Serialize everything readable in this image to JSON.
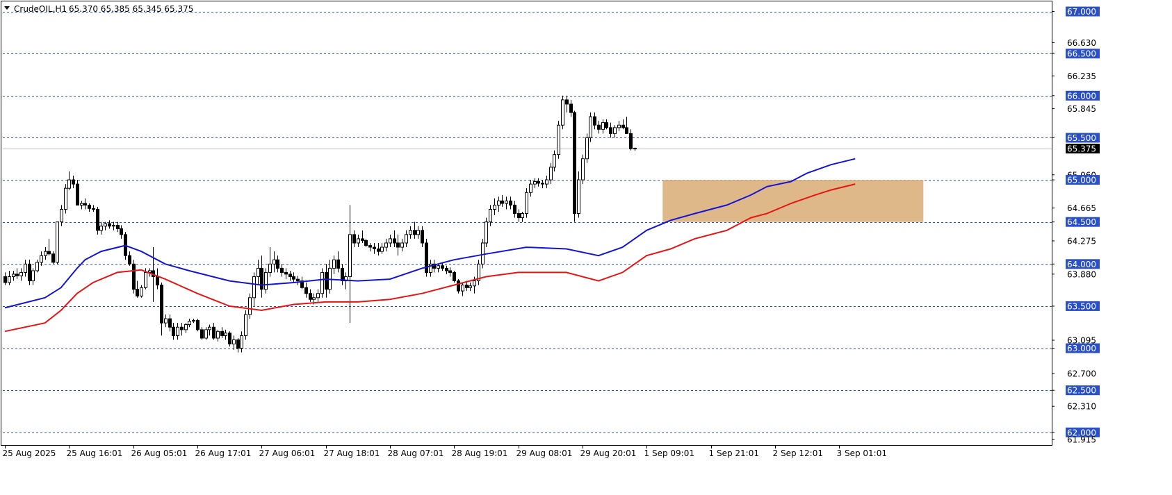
{
  "header": {
    "symbol_line": "CrudeOIL,H1",
    "ohlc": "65.370 65.385 65.345 65.375"
  },
  "colors": {
    "bull": "#ffffff",
    "bear": "#000000",
    "ma_fast": "#1414d6",
    "ma_slow": "#e81414",
    "level": "#2a50c8",
    "zone": "#d9ae78",
    "current": "#000000"
  },
  "chart_data": {
    "type": "candlestick",
    "ylim": [
      61.85,
      67.12
    ],
    "y_ticks": [
      "67.000",
      "66.630",
      "66.500",
      "66.235",
      "66.000",
      "65.845",
      "65.500",
      "65.060",
      "65.000",
      "64.665",
      "64.500",
      "64.275",
      "64.000",
      "63.880",
      "63.500",
      "63.095",
      "63.000",
      "62.700",
      "62.500",
      "62.310",
      "62.000",
      "61.915"
    ],
    "highlighted_levels": [
      "67.000",
      "66.500",
      "66.000",
      "65.500",
      "65.000",
      "64.500",
      "64.000",
      "63.500",
      "63.000",
      "62.500",
      "62.000"
    ],
    "current_price": "65.375",
    "x_labels": [
      {
        "label": "25 Aug 2025",
        "index": 0
      },
      {
        "label": "25 Aug 16:01",
        "index": 16
      },
      {
        "label": "26 Aug 05:01",
        "index": 32
      },
      {
        "label": "26 Aug 17:01",
        "index": 48
      },
      {
        "label": "27 Aug 06:01",
        "index": 64
      },
      {
        "label": "27 Aug 18:01",
        "index": 80
      },
      {
        "label": "28 Aug 07:01",
        "index": 96
      },
      {
        "label": "28 Aug 19:01",
        "index": 112
      },
      {
        "label": "29 Aug 08:01",
        "index": 128
      },
      {
        "label": "29 Aug 20:01",
        "index": 144
      },
      {
        "label": "1 Sep 09:01",
        "index": 160
      },
      {
        "label": "1 Sep 21:01",
        "index": 176
      },
      {
        "label": "2 Sep 12:01",
        "index": 192
      },
      {
        "label": "3 Sep 01:01",
        "index": 208
      }
    ],
    "zone": {
      "from_index": 164,
      "to_index": 229,
      "low": 64.5,
      "high": 65.0
    },
    "candles": [
      [
        63.85,
        63.9,
        63.75,
        63.78
      ],
      [
        63.78,
        63.92,
        63.75,
        63.85
      ],
      [
        63.85,
        63.92,
        63.8,
        63.88
      ],
      [
        63.88,
        63.95,
        63.82,
        63.86
      ],
      [
        63.86,
        63.95,
        63.8,
        63.9
      ],
      [
        63.9,
        64.05,
        63.85,
        64.0
      ],
      [
        64.0,
        64.05,
        63.75,
        63.8
      ],
      [
        63.8,
        63.95,
        63.75,
        63.92
      ],
      [
        63.92,
        64.05,
        63.9,
        64.02
      ],
      [
        64.02,
        64.15,
        63.98,
        64.1
      ],
      [
        64.1,
        64.2,
        64.05,
        64.15
      ],
      [
        64.15,
        64.3,
        64.1,
        64.12
      ],
      [
        64.12,
        64.15,
        64.0,
        64.02
      ],
      [
        64.02,
        64.2,
        64.0,
        64.5
      ],
      [
        64.5,
        64.7,
        64.45,
        64.65
      ],
      [
        64.65,
        64.95,
        64.6,
        64.9
      ],
      [
        64.9,
        65.1,
        64.88,
        65.0
      ],
      [
        65.0,
        65.05,
        64.9,
        64.95
      ],
      [
        64.95,
        65.0,
        64.8,
        64.7
      ],
      [
        64.7,
        64.75,
        64.65,
        64.72
      ],
      [
        64.72,
        64.78,
        64.65,
        64.7
      ],
      [
        64.7,
        64.72,
        64.62,
        64.66
      ],
      [
        64.66,
        64.7,
        64.62,
        64.65
      ],
      [
        64.65,
        64.68,
        64.35,
        64.4
      ],
      [
        64.4,
        64.5,
        64.35,
        64.45
      ],
      [
        64.45,
        64.5,
        64.4,
        64.48
      ],
      [
        64.48,
        64.52,
        64.42,
        64.45
      ],
      [
        64.45,
        64.5,
        64.4,
        64.46
      ],
      [
        64.46,
        64.5,
        64.38,
        64.42
      ],
      [
        64.42,
        64.46,
        64.3,
        64.35
      ],
      [
        64.35,
        64.38,
        64.05,
        64.1
      ],
      [
        64.1,
        64.15,
        63.98,
        64.0
      ],
      [
        64.0,
        64.05,
        63.65,
        63.7
      ],
      [
        63.7,
        63.8,
        63.6,
        63.62
      ],
      [
        63.62,
        63.75,
        63.6,
        63.72
      ],
      [
        63.72,
        63.95,
        63.7,
        63.9
      ],
      [
        63.9,
        63.95,
        63.85,
        63.92
      ],
      [
        63.92,
        64.2,
        63.55,
        63.85
      ],
      [
        63.85,
        63.95,
        63.7,
        63.75
      ],
      [
        63.75,
        63.78,
        63.15,
        63.3
      ],
      [
        63.3,
        63.4,
        63.25,
        63.35
      ],
      [
        63.35,
        63.4,
        63.2,
        63.25
      ],
      [
        63.25,
        63.3,
        63.1,
        63.15
      ],
      [
        63.15,
        63.3,
        63.1,
        63.25
      ],
      [
        63.25,
        63.3,
        63.15,
        63.22
      ],
      [
        63.22,
        63.3,
        63.18,
        63.28
      ],
      [
        63.28,
        63.35,
        63.25,
        63.32
      ],
      [
        63.32,
        63.35,
        63.3,
        63.33
      ],
      [
        63.33,
        63.35,
        63.2,
        63.22
      ],
      [
        63.22,
        63.25,
        63.1,
        63.12
      ],
      [
        63.12,
        63.25,
        63.1,
        63.22
      ],
      [
        63.22,
        63.28,
        63.15,
        63.25
      ],
      [
        63.25,
        63.3,
        63.1,
        63.12
      ],
      [
        63.12,
        63.22,
        63.08,
        63.2
      ],
      [
        63.2,
        63.25,
        63.12,
        63.15
      ],
      [
        63.15,
        63.22,
        63.1,
        63.18
      ],
      [
        63.18,
        63.2,
        63.02,
        63.05
      ],
      [
        63.05,
        63.15,
        62.98,
        63.1
      ],
      [
        63.1,
        63.12,
        62.95,
        63.0
      ],
      [
        63.0,
        63.2,
        62.95,
        63.15
      ],
      [
        63.15,
        63.45,
        63.1,
        63.4
      ],
      [
        63.4,
        63.65,
        63.35,
        63.6
      ],
      [
        63.6,
        63.9,
        63.5,
        63.85
      ],
      [
        63.85,
        64.05,
        63.75,
        63.95
      ],
      [
        63.95,
        64.1,
        63.6,
        63.7
      ],
      [
        63.7,
        63.95,
        63.65,
        63.9
      ],
      [
        63.9,
        64.2,
        63.85,
        64.0
      ],
      [
        64.0,
        64.15,
        63.9,
        64.05
      ],
      [
        64.05,
        64.1,
        63.9,
        63.95
      ],
      [
        63.95,
        64.0,
        63.85,
        63.9
      ],
      [
        63.9,
        63.95,
        63.82,
        63.88
      ],
      [
        63.88,
        63.92,
        63.8,
        63.85
      ],
      [
        63.85,
        63.9,
        63.78,
        63.82
      ],
      [
        63.82,
        63.86,
        63.75,
        63.8
      ],
      [
        63.8,
        63.85,
        63.7,
        63.72
      ],
      [
        63.72,
        63.78,
        63.6,
        63.65
      ],
      [
        63.65,
        63.7,
        63.55,
        63.58
      ],
      [
        63.58,
        63.65,
        63.52,
        63.6
      ],
      [
        63.6,
        63.7,
        63.55,
        63.65
      ],
      [
        63.65,
        63.95,
        63.6,
        63.9
      ],
      [
        63.9,
        64.0,
        63.6,
        63.7
      ],
      [
        63.7,
        64.05,
        63.65,
        63.95
      ],
      [
        63.95,
        64.1,
        63.88,
        64.05
      ],
      [
        64.05,
        64.15,
        63.9,
        63.95
      ],
      [
        63.95,
        64.0,
        63.75,
        63.8
      ],
      [
        63.8,
        63.9,
        63.7,
        63.85
      ],
      [
        63.85,
        64.7,
        63.3,
        64.35
      ],
      [
        64.35,
        64.4,
        64.2,
        64.25
      ],
      [
        64.25,
        64.35,
        64.2,
        64.3
      ],
      [
        64.3,
        64.4,
        64.25,
        64.28
      ],
      [
        64.28,
        64.3,
        64.2,
        64.22
      ],
      [
        64.22,
        64.25,
        64.15,
        64.2
      ],
      [
        64.2,
        64.25,
        64.12,
        64.18
      ],
      [
        64.18,
        64.25,
        64.1,
        64.15
      ],
      [
        64.15,
        64.25,
        64.12,
        64.2
      ],
      [
        64.2,
        64.3,
        64.15,
        64.25
      ],
      [
        64.25,
        64.35,
        64.2,
        64.3
      ],
      [
        64.3,
        64.4,
        64.2,
        64.25
      ],
      [
        64.25,
        64.35,
        64.1,
        64.2
      ],
      [
        64.2,
        64.3,
        64.15,
        64.25
      ],
      [
        64.25,
        64.4,
        64.2,
        64.35
      ],
      [
        64.35,
        64.45,
        64.3,
        64.4
      ],
      [
        64.4,
        64.5,
        64.3,
        64.35
      ],
      [
        64.35,
        64.45,
        64.3,
        64.4
      ],
      [
        64.4,
        64.45,
        64.2,
        64.25
      ],
      [
        64.25,
        64.3,
        63.85,
        63.9
      ],
      [
        63.9,
        64.05,
        63.85,
        64.0
      ],
      [
        64.0,
        64.05,
        63.9,
        63.95
      ],
      [
        63.95,
        64.0,
        63.9,
        63.98
      ],
      [
        63.98,
        64.02,
        63.92,
        63.95
      ],
      [
        63.95,
        63.98,
        63.88,
        63.92
      ],
      [
        63.92,
        63.96,
        63.85,
        63.9
      ],
      [
        63.9,
        63.92,
        63.78,
        63.8
      ],
      [
        63.8,
        63.82,
        63.65,
        63.68
      ],
      [
        63.68,
        63.78,
        63.62,
        63.75
      ],
      [
        63.75,
        63.8,
        63.68,
        63.72
      ],
      [
        63.72,
        63.78,
        63.68,
        63.74
      ],
      [
        63.74,
        63.85,
        63.65,
        63.8
      ],
      [
        63.8,
        64.05,
        63.75,
        64.0
      ],
      [
        64.0,
        64.3,
        63.95,
        64.25
      ],
      [
        64.25,
        64.55,
        64.2,
        64.5
      ],
      [
        64.5,
        64.7,
        64.45,
        64.65
      ],
      [
        64.65,
        64.78,
        64.58,
        64.7
      ],
      [
        64.7,
        64.8,
        64.62,
        64.75
      ],
      [
        64.75,
        64.82,
        64.68,
        64.72
      ],
      [
        64.72,
        64.8,
        64.65,
        64.75
      ],
      [
        64.75,
        64.8,
        64.65,
        64.7
      ],
      [
        64.7,
        64.75,
        64.55,
        64.6
      ],
      [
        64.6,
        64.65,
        64.5,
        64.55
      ],
      [
        64.55,
        64.62,
        64.5,
        64.6
      ],
      [
        64.6,
        64.9,
        64.55,
        64.85
      ],
      [
        64.85,
        65.0,
        64.8,
        64.95
      ],
      [
        64.95,
        65.02,
        64.9,
        64.98
      ],
      [
        64.98,
        65.02,
        64.92,
        64.96
      ],
      [
        64.96,
        65.0,
        64.9,
        64.95
      ],
      [
        64.95,
        65.05,
        64.9,
        65.0
      ],
      [
        65.0,
        65.2,
        64.95,
        65.15
      ],
      [
        65.15,
        65.35,
        65.1,
        65.3
      ],
      [
        65.3,
        65.7,
        65.25,
        65.65
      ],
      [
        65.65,
        66.0,
        65.6,
        65.95
      ],
      [
        65.95,
        66.0,
        65.8,
        65.9
      ],
      [
        65.9,
        65.95,
        65.75,
        65.8
      ],
      [
        65.8,
        65.82,
        64.5,
        64.6
      ],
      [
        64.6,
        65.1,
        64.55,
        65.0
      ],
      [
        65.0,
        65.3,
        64.95,
        65.25
      ],
      [
        65.25,
        65.55,
        65.2,
        65.5
      ],
      [
        65.5,
        65.8,
        65.45,
        65.75
      ],
      [
        65.75,
        65.8,
        65.6,
        65.65
      ],
      [
        65.65,
        65.7,
        65.55,
        65.6
      ],
      [
        65.6,
        65.72,
        65.55,
        65.68
      ],
      [
        65.68,
        65.72,
        65.6,
        65.62
      ],
      [
        65.62,
        65.68,
        65.5,
        65.55
      ],
      [
        65.55,
        65.65,
        65.5,
        65.62
      ],
      [
        65.62,
        65.7,
        65.58,
        65.65
      ],
      [
        65.65,
        65.72,
        65.6,
        65.62
      ],
      [
        65.62,
        65.75,
        65.55,
        65.55
      ],
      [
        65.55,
        65.6,
        65.35,
        65.37
      ],
      [
        65.37,
        65.385,
        65.345,
        65.375
      ]
    ],
    "ma_fast": [
      [
        0,
        63.48
      ],
      [
        10,
        63.6
      ],
      [
        14,
        63.72
      ],
      [
        18,
        63.95
      ],
      [
        20,
        64.05
      ],
      [
        24,
        64.15
      ],
      [
        30,
        64.22
      ],
      [
        34,
        64.15
      ],
      [
        40,
        64.0
      ],
      [
        46,
        63.92
      ],
      [
        56,
        63.8
      ],
      [
        64,
        63.75
      ],
      [
        72,
        63.78
      ],
      [
        80,
        63.82
      ],
      [
        88,
        63.8
      ],
      [
        96,
        63.82
      ],
      [
        104,
        63.95
      ],
      [
        112,
        64.05
      ],
      [
        120,
        64.12
      ],
      [
        130,
        64.2
      ],
      [
        140,
        64.18
      ],
      [
        148,
        64.1
      ],
      [
        154,
        64.2
      ],
      [
        160,
        64.4
      ],
      [
        166,
        64.52
      ],
      [
        172,
        64.6
      ],
      [
        180,
        64.7
      ],
      [
        186,
        64.82
      ],
      [
        190,
        64.92
      ],
      [
        196,
        64.98
      ],
      [
        200,
        65.08
      ],
      [
        206,
        65.18
      ],
      [
        212,
        65.25
      ]
    ],
    "ma_slow": [
      [
        0,
        63.2
      ],
      [
        10,
        63.3
      ],
      [
        14,
        63.45
      ],
      [
        18,
        63.65
      ],
      [
        22,
        63.78
      ],
      [
        28,
        63.9
      ],
      [
        34,
        63.93
      ],
      [
        40,
        63.82
      ],
      [
        48,
        63.65
      ],
      [
        56,
        63.5
      ],
      [
        64,
        63.45
      ],
      [
        72,
        63.52
      ],
      [
        80,
        63.55
      ],
      [
        88,
        63.55
      ],
      [
        96,
        63.58
      ],
      [
        104,
        63.65
      ],
      [
        112,
        63.75
      ],
      [
        120,
        63.85
      ],
      [
        128,
        63.9
      ],
      [
        140,
        63.9
      ],
      [
        148,
        63.8
      ],
      [
        154,
        63.9
      ],
      [
        160,
        64.1
      ],
      [
        166,
        64.18
      ],
      [
        172,
        64.3
      ],
      [
        180,
        64.4
      ],
      [
        186,
        64.55
      ],
      [
        190,
        64.6
      ],
      [
        196,
        64.72
      ],
      [
        202,
        64.82
      ],
      [
        206,
        64.88
      ],
      [
        212,
        64.95
      ]
    ]
  }
}
